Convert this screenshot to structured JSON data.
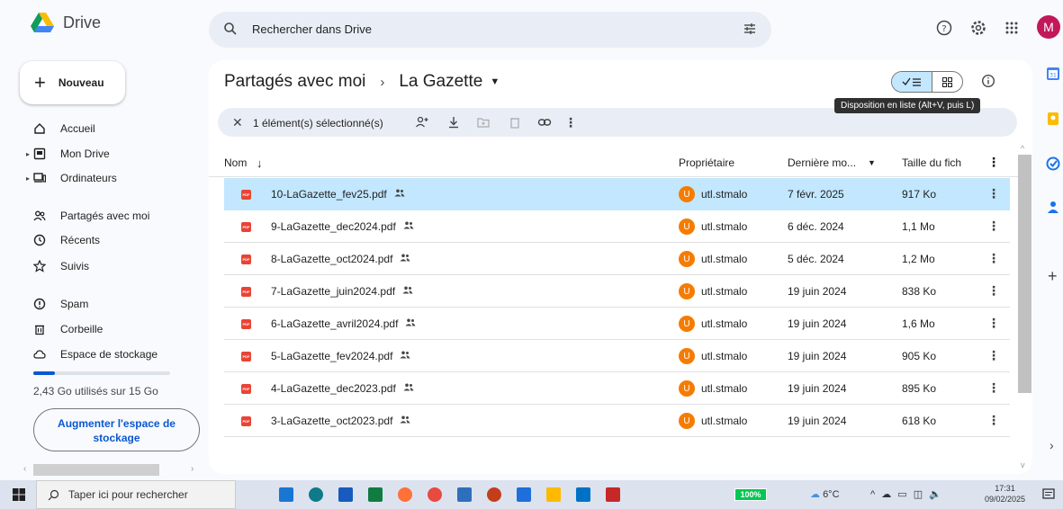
{
  "app": {
    "name": "Drive",
    "avatar_letter": "M",
    "accent": "#0b57d0",
    "avatar_color": "#c2185b"
  },
  "search": {
    "placeholder": "Rechercher dans Drive"
  },
  "sidebar": {
    "new_label": "Nouveau",
    "items": [
      {
        "label": "Accueil",
        "icon": "home-icon"
      },
      {
        "label": "Mon Drive",
        "icon": "drive-icon"
      },
      {
        "label": "Ordinateurs",
        "icon": "computer-icon"
      },
      {
        "label": "Partagés avec moi",
        "icon": "people-icon"
      },
      {
        "label": "Récents",
        "icon": "clock-icon"
      },
      {
        "label": "Suivis",
        "icon": "star-icon"
      },
      {
        "label": "Spam",
        "icon": "spam-icon"
      },
      {
        "label": "Corbeille",
        "icon": "trash-icon"
      },
      {
        "label": "Espace de stockage",
        "icon": "cloud-icon"
      }
    ],
    "storage_text": "2,43 Go utilisés sur 15 Go",
    "storage_fraction": 0.16,
    "upgrade_label": "Augmenter l'espace de stockage"
  },
  "main": {
    "breadcrumb": [
      "Partagés avec moi",
      "La Gazette"
    ],
    "tooltip": "Disposition en liste (Alt+V, puis L)",
    "selection_text": "1 élément(s) sélectionné(s)",
    "columns": {
      "name": "Nom",
      "owner": "Propriétaire",
      "modified": "Dernière mo...",
      "size": "Taille du fich"
    },
    "files": [
      {
        "name": "10-LaGazette_fev25.pdf",
        "owner": "utl.stmalo",
        "owner_initial": "U",
        "date": "7 févr. 2025",
        "size": "917 Ko",
        "selected": true
      },
      {
        "name": "9-LaGazette_dec2024.pdf",
        "owner": "utl.stmalo",
        "owner_initial": "U",
        "date": "6 déc. 2024",
        "size": "1,1 Mo",
        "selected": false
      },
      {
        "name": "8-LaGazette_oct2024.pdf",
        "owner": "utl.stmalo",
        "owner_initial": "U",
        "date": "5 déc. 2024",
        "size": "1,2 Mo",
        "selected": false
      },
      {
        "name": "7-LaGazette_juin2024.pdf",
        "owner": "utl.stmalo",
        "owner_initial": "U",
        "date": "19 juin 2024",
        "size": "838 Ko",
        "selected": false
      },
      {
        "name": "6-LaGazette_avril2024.pdf",
        "owner": "utl.stmalo",
        "owner_initial": "U",
        "date": "19 juin 2024",
        "size": "1,6 Mo",
        "selected": false
      },
      {
        "name": "5-LaGazette_fev2024.pdf",
        "owner": "utl.stmalo",
        "owner_initial": "U",
        "date": "19 juin 2024",
        "size": "905 Ko",
        "selected": false
      },
      {
        "name": "4-LaGazette_dec2023.pdf",
        "owner": "utl.stmalo",
        "owner_initial": "U",
        "date": "19 juin 2024",
        "size": "895 Ko",
        "selected": false
      },
      {
        "name": "3-LaGazette_oct2023.pdf",
        "owner": "utl.stmalo",
        "owner_initial": "U",
        "date": "19 juin 2024",
        "size": "618 Ko",
        "selected": false
      }
    ]
  },
  "taskbar": {
    "search_placeholder": "Taper ici pour rechercher",
    "battery": "100%",
    "weather": "6°C",
    "time": "17:31",
    "date": "09/02/2025"
  }
}
